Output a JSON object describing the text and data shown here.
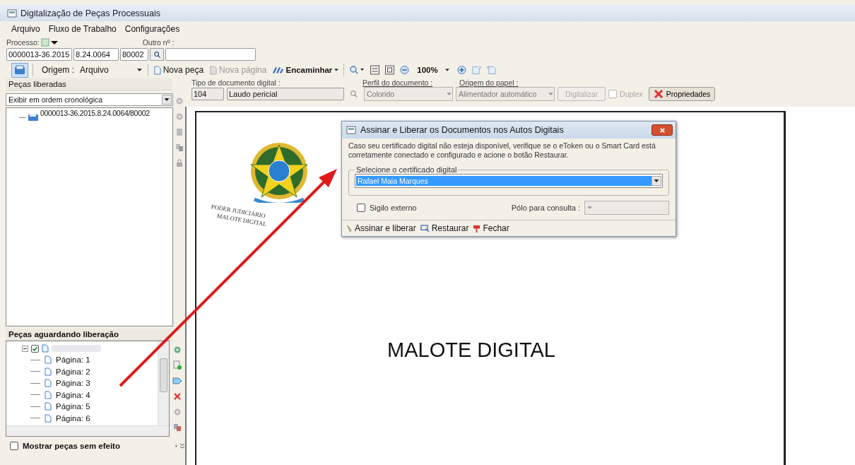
{
  "window": {
    "title": "Digitalização de Peças Processuais"
  },
  "menu": [
    {
      "label": "Arquivo"
    },
    {
      "label": "Fluxo de Trabalho"
    },
    {
      "label": "Configurações"
    }
  ],
  "process": {
    "label": "Processo:",
    "other_label": "Outro nº :",
    "number": "0000013-36.2015",
    "segment": "8.24.0064",
    "suffix": "80002"
  },
  "toolbar": {
    "origin_label": "Origem :",
    "origin_value": "Arquivo",
    "zoom": "100%",
    "items": [
      {
        "label": "Nova peça",
        "disabled": false,
        "kind": "new-piece"
      },
      {
        "label": "Nova página",
        "disabled": true,
        "kind": "new-page"
      },
      {
        "label": "Encaminhar",
        "disabled": false,
        "kind": "forward"
      }
    ]
  },
  "document_fields": {
    "type_label": "Tipo de documento digital :",
    "type_code": "104",
    "type_name": "Laudo pericial",
    "profile_label": "Perfil do documento :",
    "profile_value": "Colorido",
    "paper_label": "Origem do papel :",
    "paper_value": "Alimentador automático",
    "scan_button": {
      "label": "Digitalizar",
      "disabled": true
    },
    "duplex": {
      "label": "Duplex",
      "checked": false,
      "disabled": true
    },
    "properties_button": "Propriedades"
  },
  "released": {
    "title": "Peças liberadas",
    "order": "Exibir em ordem cronológica",
    "items": [
      {
        "label": "0000013-36.2015.8.24.0064/80002"
      }
    ]
  },
  "pending": {
    "title": "Peças aguardando liberação",
    "root": {
      "checked": true,
      "expanded": true,
      "children": [
        {
          "label": "Página: 1"
        },
        {
          "label": "Página: 2"
        },
        {
          "label": "Página: 3"
        },
        {
          "label": "Página: 4"
        },
        {
          "label": "Página: 5"
        },
        {
          "label": "Página: 6"
        }
      ]
    },
    "show_void": {
      "label": "Mostrar peças sem efeito",
      "checked": false
    }
  },
  "document": {
    "seal_top": "PODER JUDICIÁRIO",
    "seal_bottom": "MALOTE DIGITAL",
    "heading": "MALOTE DIGITAL"
  },
  "dialog": {
    "title": "Assinar e Liberar os Documentos nos Autos Digitais",
    "message": "Caso seu certificado digital não esteja disponível, verifique se o eToken ou o Smart Card está corretamente conectado e configurado e acione o botão Restaurar.",
    "group_label": "Selecione o certificado digital",
    "certificate": "Rafael Maia Marques",
    "secret": {
      "label": "Sigilo externo",
      "checked": false
    },
    "pole_label": "Pólo para consulta :",
    "buttons": [
      {
        "label": "Assinar e liberar",
        "kind": "sign"
      },
      {
        "label": "Restaurar",
        "kind": "restore"
      },
      {
        "label": "Fechar",
        "kind": "close"
      }
    ]
  }
}
